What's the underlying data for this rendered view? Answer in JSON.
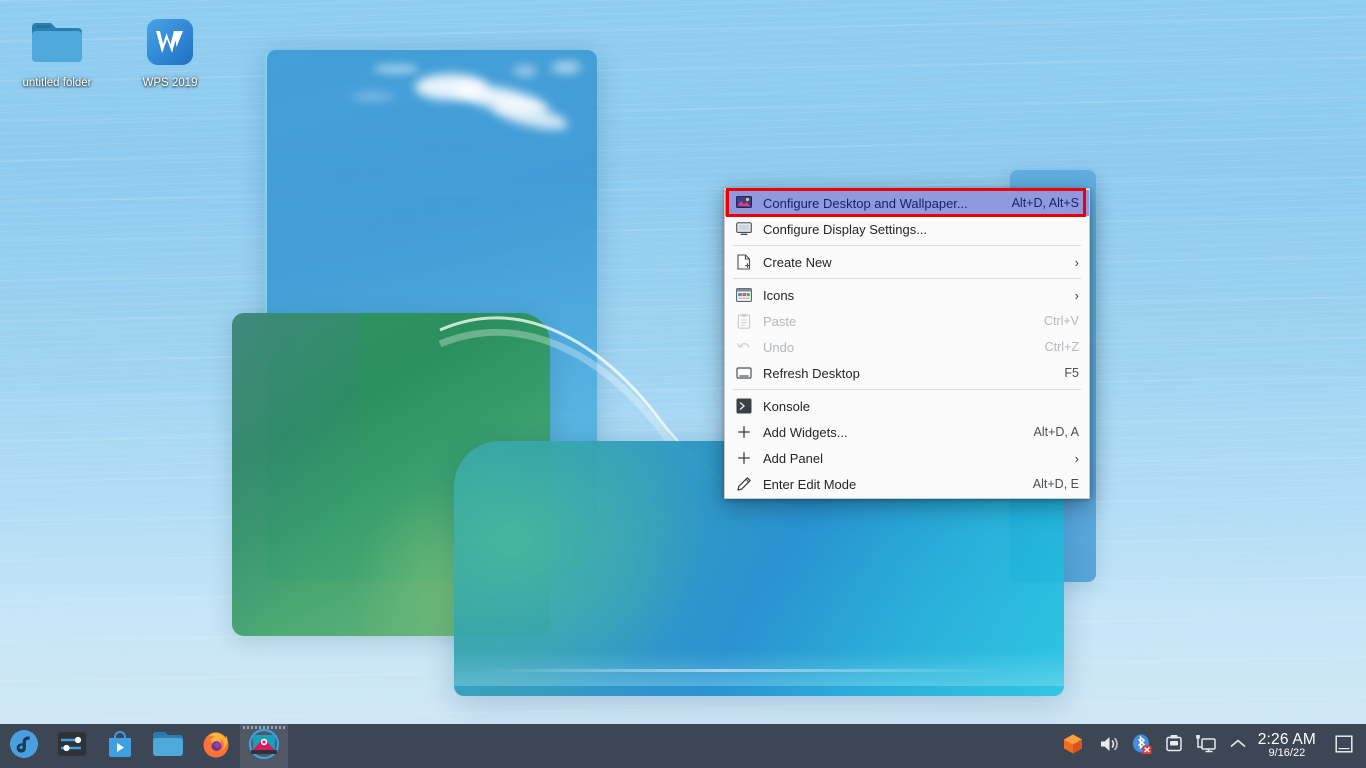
{
  "desktop": {
    "icons": [
      {
        "label": "untitled folder",
        "icon": "folder-icon"
      },
      {
        "label": "WPS 2019",
        "icon": "wps-office-icon"
      }
    ]
  },
  "context_menu": {
    "items": [
      {
        "label": "Configure Desktop and Wallpaper...",
        "shortcut": "Alt+D, Alt+S",
        "icon": "wallpaper-icon",
        "selected": true,
        "disabled": false,
        "submenu": false
      },
      {
        "label": "Configure Display Settings...",
        "shortcut": "",
        "icon": "monitor-icon",
        "selected": false,
        "disabled": false,
        "submenu": false
      },
      {
        "separator": true
      },
      {
        "label": "Create New",
        "shortcut": "",
        "icon": "new-document-icon",
        "selected": false,
        "disabled": false,
        "submenu": true
      },
      {
        "separator": true
      },
      {
        "label": "Icons",
        "shortcut": "",
        "icon": "icons-grid-icon",
        "selected": false,
        "disabled": false,
        "submenu": true
      },
      {
        "label": "Paste",
        "shortcut": "Ctrl+V",
        "icon": "clipboard-icon",
        "selected": false,
        "disabled": true,
        "submenu": false
      },
      {
        "label": "Undo",
        "shortcut": "Ctrl+Z",
        "icon": "undo-icon",
        "selected": false,
        "disabled": true,
        "submenu": false
      },
      {
        "label": "Refresh Desktop",
        "shortcut": "F5",
        "icon": "refresh-icon",
        "selected": false,
        "disabled": false,
        "submenu": false
      },
      {
        "separator": true
      },
      {
        "label": "Konsole",
        "shortcut": "",
        "icon": "konsole-icon",
        "selected": false,
        "disabled": false,
        "submenu": false
      },
      {
        "label": "Add Widgets...",
        "shortcut": "Alt+D, A",
        "icon": "plus-icon",
        "selected": false,
        "disabled": false,
        "submenu": false
      },
      {
        "label": "Add Panel",
        "shortcut": "",
        "icon": "plus-icon",
        "selected": false,
        "disabled": false,
        "submenu": true
      },
      {
        "label": "Enter Edit Mode",
        "shortcut": "Alt+D, E",
        "icon": "pencil-icon",
        "selected": false,
        "disabled": false,
        "submenu": false
      }
    ],
    "highlight_color": "#ee0000",
    "selected_color": "#9099e0"
  },
  "taskbar": {
    "background_color": "#3d4654",
    "launchers": [
      {
        "name": "fedora-menu-icon",
        "title": "Application Menu"
      },
      {
        "name": "settings-sliders-icon",
        "title": "System Settings"
      },
      {
        "name": "software-store-icon",
        "title": "Software"
      },
      {
        "name": "file-manager-icon",
        "title": "File Manager"
      },
      {
        "name": "firefox-icon",
        "title": "Firefox"
      },
      {
        "name": "image-viewer-icon",
        "title": "Image Viewer",
        "active": true
      }
    ],
    "tray": [
      {
        "name": "app-tray-icon",
        "title": "Application"
      },
      {
        "name": "volume-icon",
        "title": "Volume"
      },
      {
        "name": "bluetooth-off-icon",
        "title": "Bluetooth disabled"
      },
      {
        "name": "usb-drive-icon",
        "title": "Removable Devices"
      },
      {
        "name": "network-display-icon",
        "title": "Network / Display"
      },
      {
        "name": "tray-expand-icon",
        "title": "Show hidden icons"
      }
    ],
    "clock": {
      "time": "2:26 AM",
      "date": "9/16/22"
    },
    "show_desktop": {
      "name": "show-desktop-button",
      "label": ""
    }
  }
}
